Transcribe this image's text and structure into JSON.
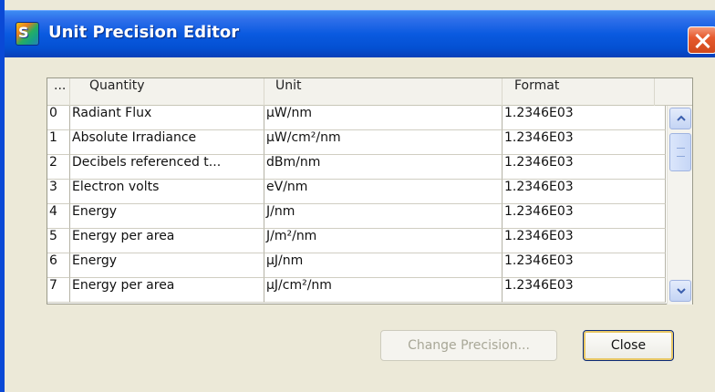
{
  "window": {
    "title": "Unit Precision Editor",
    "app_icon_text": "S",
    "colors": {
      "titlebar": "#0a5ae0",
      "close": "#e65a2e",
      "face": "#ece9d8"
    }
  },
  "table": {
    "columns": [
      "...",
      "Quantity",
      "Unit",
      "Format"
    ],
    "rows": [
      {
        "idx": "0",
        "quantity": "Radiant Flux",
        "unit": "μW/nm",
        "format": "1.2346E03"
      },
      {
        "idx": "1",
        "quantity": "Absolute Irradiance",
        "unit": "μW/cm²/nm",
        "format": "1.2346E03"
      },
      {
        "idx": "2",
        "quantity": "Decibels referenced t...",
        "unit": "dBm/nm",
        "format": "1.2346E03"
      },
      {
        "idx": "3",
        "quantity": "Electron volts",
        "unit": "eV/nm",
        "format": "1.2346E03"
      },
      {
        "idx": "4",
        "quantity": "Energy",
        "unit": "J/nm",
        "format": "1.2346E03"
      },
      {
        "idx": "5",
        "quantity": "Energy per area",
        "unit": "J/m²/nm",
        "format": "1.2346E03"
      },
      {
        "idx": "6",
        "quantity": "Energy",
        "unit": "μJ/nm",
        "format": "1.2346E03"
      },
      {
        "idx": "7",
        "quantity": "Energy per area",
        "unit": "μJ/cm²/nm",
        "format": "1.2346E03"
      }
    ]
  },
  "buttons": {
    "change_precision": "Change Precision...",
    "close": "Close"
  },
  "icons": {
    "app": "app-logo-icon",
    "close": "close-icon",
    "scroll_up": "chevron-up-icon",
    "scroll_down": "chevron-down-icon"
  }
}
